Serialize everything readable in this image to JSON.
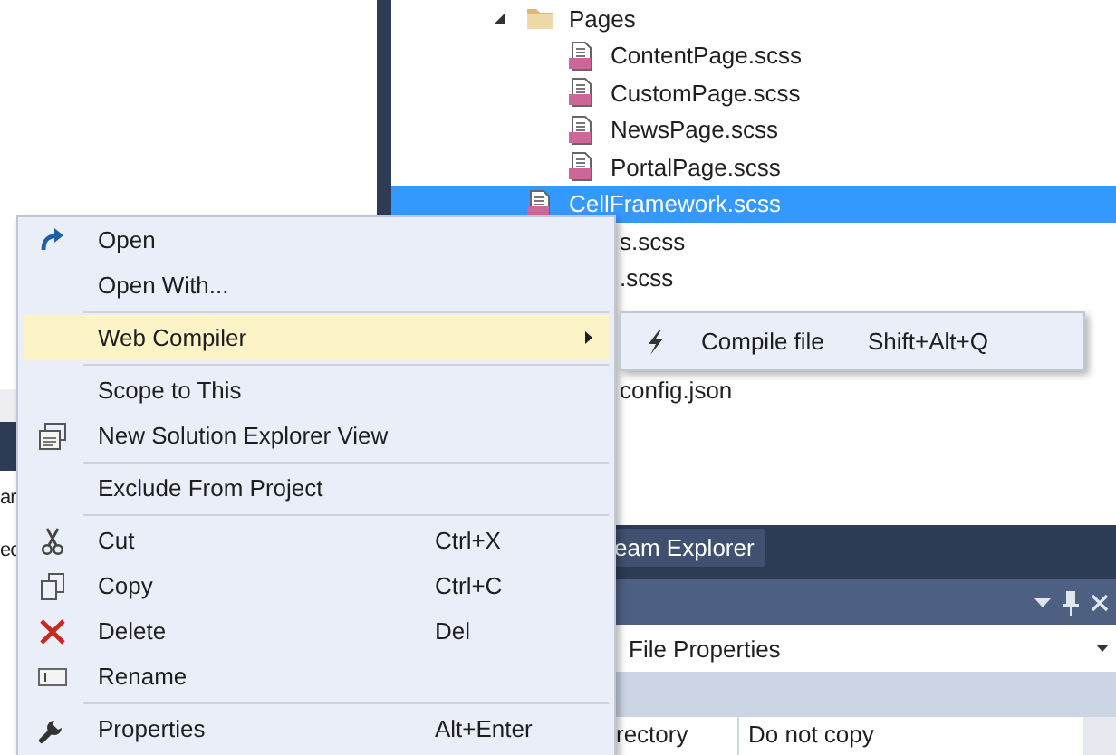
{
  "left_panel": {
    "fragments": [
      "ar",
      "ec"
    ]
  },
  "solution_explorer": {
    "items": [
      {
        "label": "Pages",
        "kind": "folder",
        "expanded": true,
        "selected": false,
        "children": [
          {
            "label": "ContentPage.scss",
            "kind": "scss",
            "selected": false
          },
          {
            "label": "CustomPage.scss",
            "kind": "scss",
            "selected": false
          },
          {
            "label": "NewsPage.scss",
            "kind": "scss",
            "selected": false
          },
          {
            "label": "PortalPage.scss",
            "kind": "scss",
            "selected": false
          }
        ]
      },
      {
        "label": "CellFramework.scss",
        "kind": "scss",
        "selected": true
      }
    ],
    "partly_hidden_items": [
      {
        "label": "s.scss"
      },
      {
        "label": ".scss"
      },
      {
        "label": "config.json"
      }
    ]
  },
  "context_menu": {
    "items": [
      {
        "kind": "item",
        "label": "Open",
        "selected": false
      },
      {
        "kind": "item",
        "label": "Open With...",
        "selected": false
      },
      {
        "kind": "separator"
      },
      {
        "kind": "item",
        "label": "Web Compiler",
        "has_submenu": true,
        "selected": true
      },
      {
        "kind": "separator"
      },
      {
        "kind": "item",
        "label": "Scope to This",
        "selected": false
      },
      {
        "kind": "item",
        "label": "New Solution Explorer View",
        "selected": false
      },
      {
        "kind": "separator"
      },
      {
        "kind": "item",
        "label": "Exclude From Project",
        "selected": false
      },
      {
        "kind": "separator"
      },
      {
        "kind": "item",
        "label": "Cut",
        "shortcut": "Ctrl+X",
        "selected": false
      },
      {
        "kind": "item",
        "label": "Copy",
        "shortcut": "Ctrl+C",
        "selected": false
      },
      {
        "kind": "item",
        "label": "Delete",
        "shortcut": "Del",
        "selected": false
      },
      {
        "kind": "item",
        "label": "Rename",
        "selected": false
      },
      {
        "kind": "separator"
      },
      {
        "kind": "item",
        "label": "Properties",
        "shortcut": "Alt+Enter",
        "selected": false
      }
    ]
  },
  "submenu": {
    "items": [
      {
        "kind": "item",
        "label": "Compile file",
        "shortcut": "Shift+Alt+Q",
        "selected": false
      }
    ]
  },
  "bottom_panel": {
    "tabs": [
      {
        "label": "eam Explorer",
        "selected": false
      }
    ],
    "dropdown": {
      "value": "File Properties"
    },
    "rows": [
      {
        "name": "rectory",
        "value": "Do not copy"
      }
    ]
  }
}
